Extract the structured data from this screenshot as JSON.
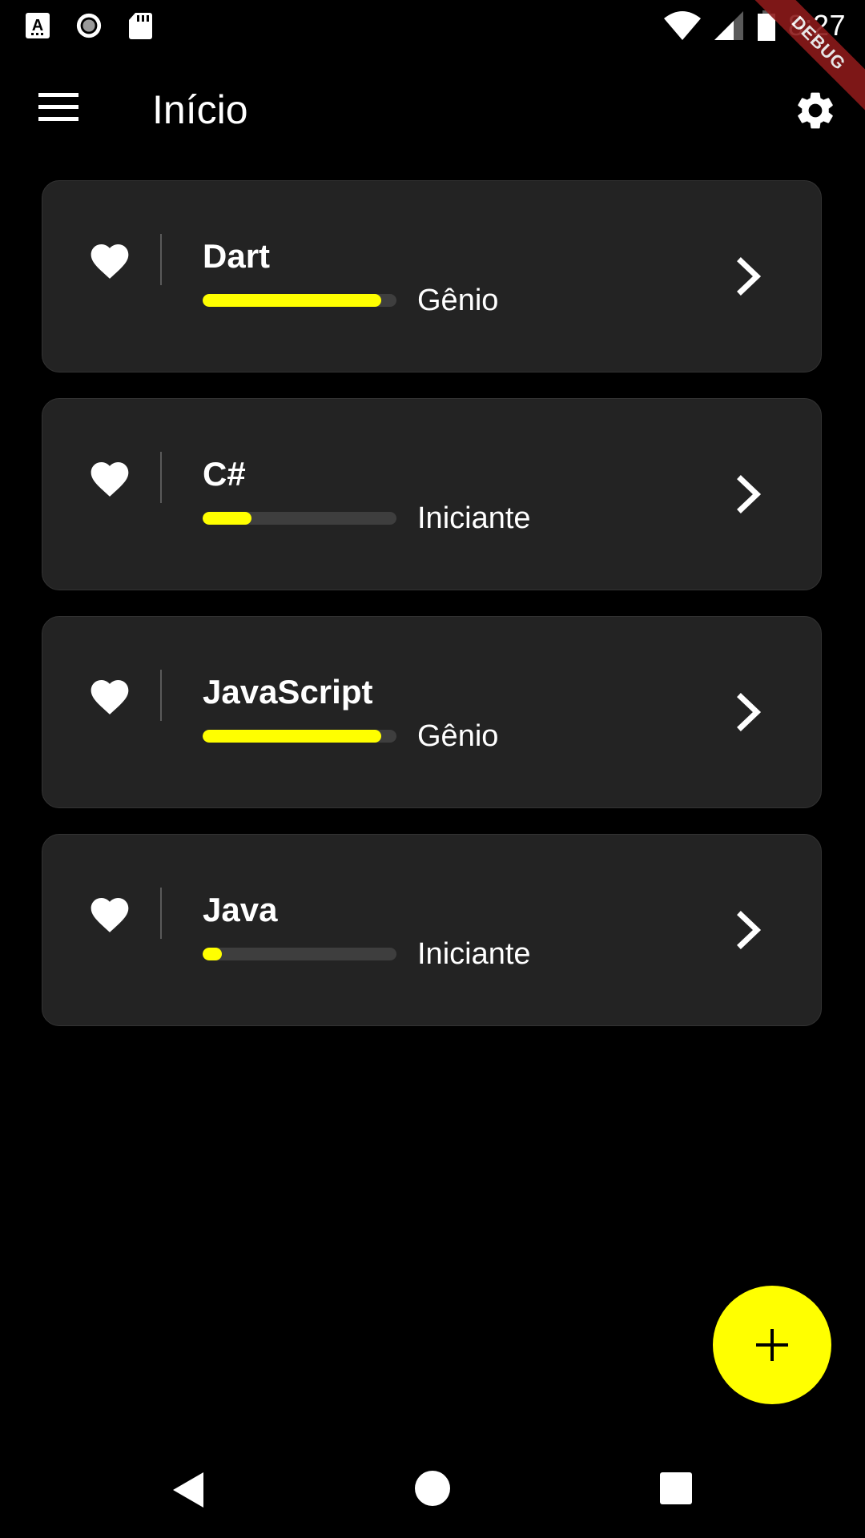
{
  "status_bar": {
    "time": "8:27",
    "left_icons": [
      "accessibility-icon",
      "record-icon",
      "sd-card-icon"
    ],
    "right_icons": [
      "wifi-icon",
      "signal-icon",
      "battery-icon"
    ]
  },
  "debug_banner": {
    "label": "DEBUG"
  },
  "app_bar": {
    "title": "Início",
    "menu_icon": "menu-icon",
    "settings_icon": "gear-icon"
  },
  "cards": [
    {
      "title": "Dart",
      "progress": 0.92,
      "level": "Gênio"
    },
    {
      "title": "C#",
      "progress": 0.25,
      "level": "Iniciante"
    },
    {
      "title": "JavaScript",
      "progress": 0.92,
      "level": "Gênio"
    },
    {
      "title": "Java",
      "progress": 0.1,
      "level": "Iniciante"
    }
  ],
  "fab": {
    "icon": "plus-icon"
  },
  "nav_bar": {
    "icons": [
      "back-icon",
      "home-icon",
      "recents-icon"
    ]
  },
  "colors": {
    "background": "#000000",
    "card": "#232323",
    "accent": "#ffff00",
    "track": "#3e3e3e",
    "debug": "#8b1a1a"
  }
}
